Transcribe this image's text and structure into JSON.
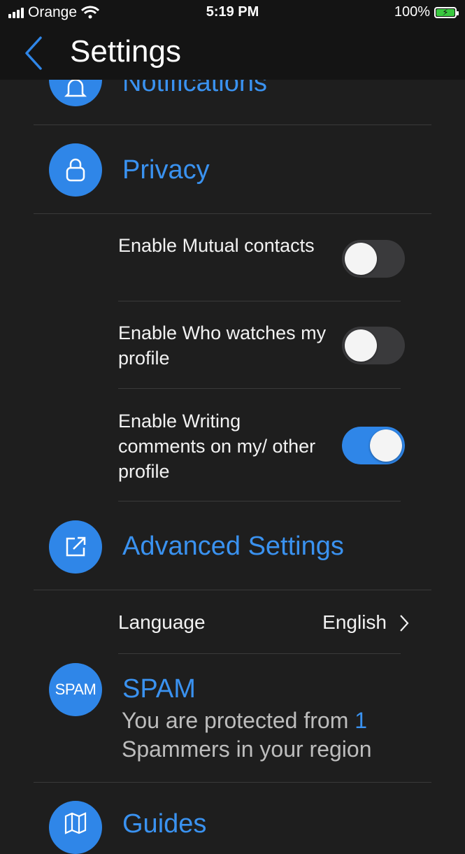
{
  "status_bar": {
    "carrier": "Orange",
    "time": "5:19 PM",
    "battery_percent": "100%",
    "signal_bars": 4,
    "battery_level": 1.0,
    "battery_color": "#3ac840"
  },
  "header": {
    "title": "Settings",
    "back_icon": "chevron-left-icon"
  },
  "sections": {
    "notifications": {
      "title": "Notifications",
      "icon": "bell-icon"
    },
    "privacy": {
      "title": "Privacy",
      "icon": "lock-icon"
    },
    "advanced": {
      "title": "Advanced Settings",
      "icon": "external-link-icon"
    },
    "spam": {
      "title": "SPAM",
      "badge": "SPAM",
      "desc_prefix": "You are protected from",
      "count": "1",
      "desc_suffix": "Spammers in your region"
    },
    "guides": {
      "title": "Guides",
      "icon": "map-icon"
    }
  },
  "privacy_toggles": [
    {
      "label": "Enable Mutual contacts",
      "on": false
    },
    {
      "label": "Enable Who watches my profile",
      "on": false
    },
    {
      "label": "Enable Writing comments on my/ other profile",
      "on": true
    }
  ],
  "language": {
    "label": "Language",
    "value": "English"
  },
  "colors": {
    "accent": "#2f86e8",
    "background": "#1e1e1e",
    "bar": "#141414"
  }
}
